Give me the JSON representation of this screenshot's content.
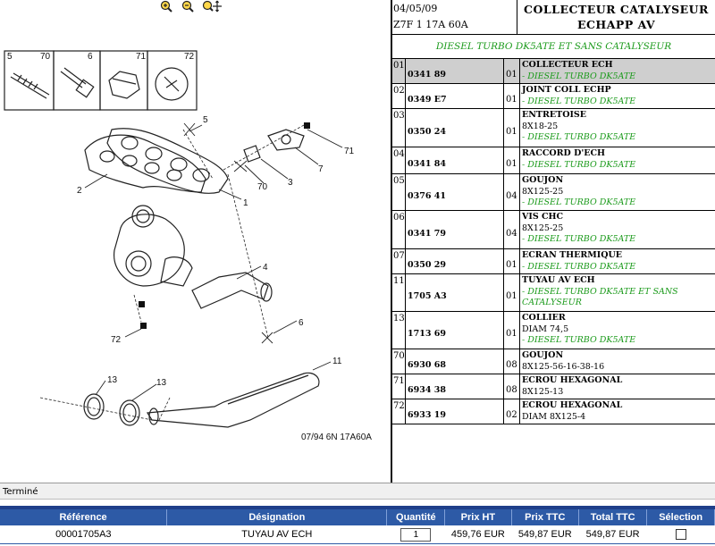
{
  "toolbar": {
    "zoom_in_icon": "zoom-in-icon",
    "zoom_out_icon": "zoom-out-icon",
    "pan_icon": "zoom-pan-icon"
  },
  "diagram": {
    "callouts": [
      "5",
      "70",
      "6",
      "71",
      "72",
      "5",
      "71",
      "7",
      "3",
      "70",
      "2",
      "1",
      "4",
      "6",
      "72",
      "13",
      "13",
      "11"
    ],
    "footer": "07/94 6N 17A60A"
  },
  "header": {
    "date": "04/05/09",
    "code": "Z7F 1 17A 60A",
    "title_line1": "COLLECTEUR CATALYSEUR",
    "title_line2": "ECHAPP AV"
  },
  "subheader": "DIESEL TURBO DK5ATE ET SANS CATALYSEUR",
  "parts": [
    {
      "rep": "01",
      "ref": "0341 89",
      "qty": "01",
      "name": "COLLECTEUR ECH",
      "lines": [
        {
          "t": "- DIESEL TURBO DK5ATE",
          "green": true
        }
      ]
    },
    {
      "rep": "02",
      "ref": "0349 E7",
      "qty": "01",
      "name": "JOINT COLL ECHP",
      "lines": [
        {
          "t": "- DIESEL TURBO DK5ATE",
          "green": true
        }
      ]
    },
    {
      "rep": "03",
      "ref": "0350 24",
      "qty": "01",
      "name": "ENTRETOISE",
      "lines": [
        {
          "t": "8X18-25",
          "green": false
        },
        {
          "t": "- DIESEL TURBO DK5ATE",
          "green": true
        }
      ]
    },
    {
      "rep": "04",
      "ref": "0341 84",
      "qty": "01",
      "name": "RACCORD D'ECH",
      "lines": [
        {
          "t": "- DIESEL TURBO DK5ATE",
          "green": true
        }
      ]
    },
    {
      "rep": "05",
      "ref": "0376 41",
      "qty": "04",
      "name": "GOUJON",
      "lines": [
        {
          "t": "8X125-25",
          "green": false
        },
        {
          "t": "- DIESEL TURBO DK5ATE",
          "green": true
        }
      ]
    },
    {
      "rep": "06",
      "ref": "0341 79",
      "qty": "04",
      "name": "VIS CHC",
      "lines": [
        {
          "t": "8X125-25",
          "green": false
        },
        {
          "t": "- DIESEL TURBO DK5ATE",
          "green": true
        }
      ]
    },
    {
      "rep": "07",
      "ref": "0350 29",
      "qty": "01",
      "name": "ECRAN THERMIQUE",
      "lines": [
        {
          "t": "- DIESEL TURBO DK5ATE",
          "green": true
        }
      ]
    },
    {
      "rep": "11",
      "ref": "1705 A3",
      "qty": "01",
      "name": "TUYAU AV ECH",
      "lines": [
        {
          "t": "- DIESEL TURBO DK5ATE ET SANS",
          "green": true
        },
        {
          "t": "CATALYSEUR",
          "green": true
        }
      ]
    },
    {
      "rep": "13",
      "ref": "1713 69",
      "qty": "01",
      "name": "COLLIER",
      "lines": [
        {
          "t": "DIAM 74,5",
          "green": false
        },
        {
          "t": "- DIESEL TURBO DK5ATE",
          "green": true
        }
      ]
    },
    {
      "rep": "70",
      "ref": "6930 68",
      "qty": "08",
      "name": "GOUJON",
      "lines": [
        {
          "t": "8X125-56-16-38-16",
          "green": false
        }
      ]
    },
    {
      "rep": "71",
      "ref": "6934 38",
      "qty": "08",
      "name": "ECROU HEXAGONAL",
      "lines": [
        {
          "t": "8X125-13",
          "green": false
        }
      ]
    },
    {
      "rep": "72",
      "ref": "6933 19",
      "qty": "02",
      "name": "ECROU HEXAGONAL",
      "lines": [
        {
          "t": "DIAM 8X125-4",
          "green": false
        }
      ]
    }
  ],
  "status": "Terminé",
  "cart": {
    "headers": [
      "Référence",
      "Désignation",
      "Quantité",
      "Prix HT",
      "Prix TTC",
      "Total TTC",
      "Sélection"
    ],
    "rows": [
      {
        "ref": "00001705A3",
        "designation": "TUYAU AV ECH",
        "qty": "1",
        "prix_ht": "459,76 EUR",
        "prix_ttc": "549,87 EUR",
        "total_ttc": "549,87 EUR",
        "selected": false
      }
    ],
    "header_color": "#2d5aa6"
  }
}
